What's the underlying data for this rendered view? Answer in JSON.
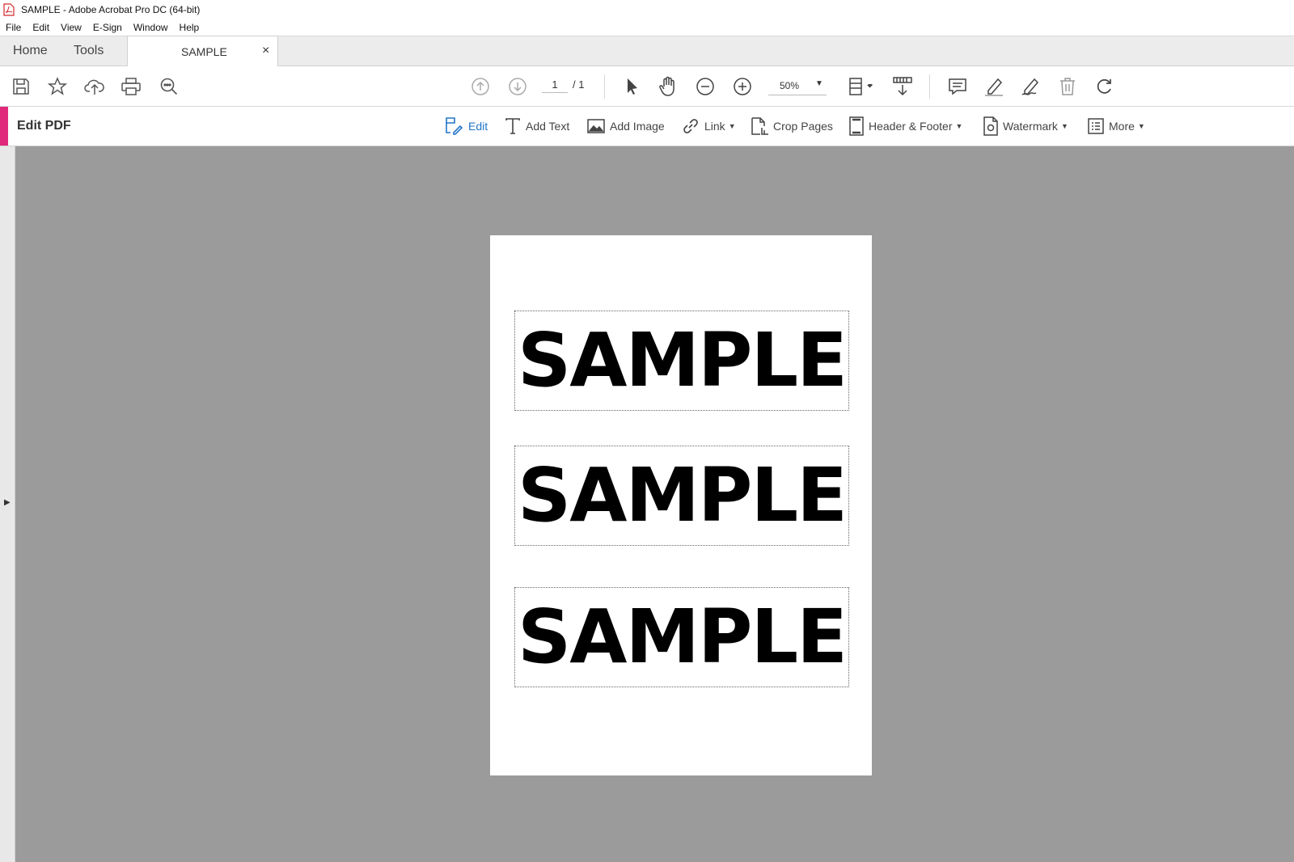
{
  "window": {
    "title": "SAMPLE - Adobe Acrobat Pro DC (64-bit)",
    "app_icon": "acrobat-pdf-icon"
  },
  "menu": [
    "File",
    "Edit",
    "View",
    "E-Sign",
    "Window",
    "Help"
  ],
  "tabs": {
    "home": "Home",
    "tools": "Tools",
    "document": "SAMPLE",
    "close_glyph": "×"
  },
  "toolbar": {
    "icons": [
      "save-icon",
      "star-icon",
      "cloud-upload-icon",
      "print-icon",
      "find-icon",
      "prev-page-icon",
      "next-page-icon",
      "select-cursor-icon",
      "hand-icon",
      "zoom-out-icon",
      "zoom-in-icon",
      "fit-page-icon",
      "scroll-mode-icon",
      "comment-icon",
      "highlight-icon",
      "sign-icon",
      "delete-icon",
      "rotate-icon"
    ],
    "page_current": "1",
    "page_total": "/ 1",
    "zoom": "50%"
  },
  "edit_bar": {
    "title": "Edit PDF",
    "items": {
      "edit": "Edit",
      "add_text": "Add Text",
      "add_image": "Add Image",
      "link": "Link",
      "crop_pages": "Crop Pages",
      "header_footer": "Header & Footer",
      "watermark": "Watermark",
      "more": "More"
    }
  },
  "document": {
    "text_blocks": [
      "SAMPLE",
      "SAMPLE",
      "SAMPLE"
    ]
  },
  "colors": {
    "accent": "#e0297a",
    "active_blue": "#2276c9",
    "workspace": "#9b9b9b"
  }
}
